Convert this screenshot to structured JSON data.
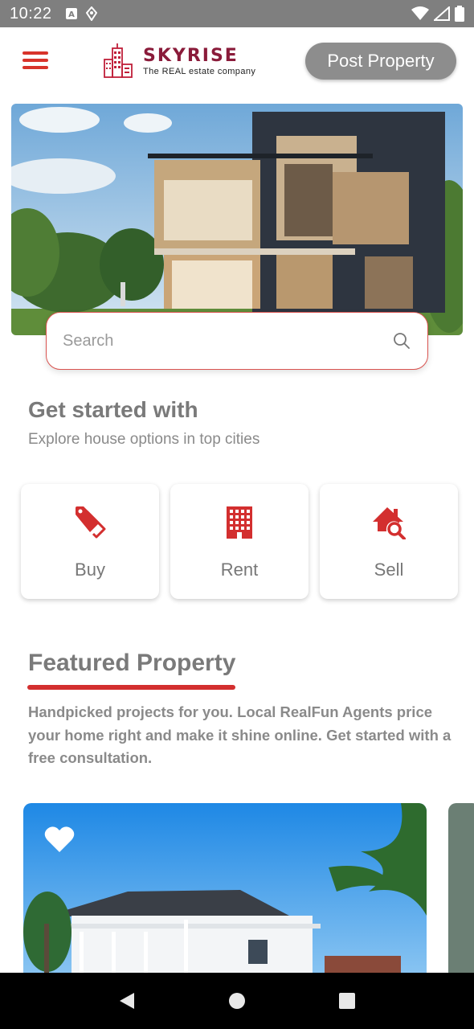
{
  "status_bar": {
    "time": "10:22"
  },
  "header": {
    "logo_title": "SKYRISE",
    "logo_tagline": "The REAL estate company",
    "post_button": "Post Property"
  },
  "search": {
    "placeholder": "Search"
  },
  "get_started": {
    "title": "Get started with",
    "subtitle": "Explore house options in top cities"
  },
  "categories": [
    {
      "label": "Buy",
      "icon": "tag-icon"
    },
    {
      "label": "Rent",
      "icon": "building-icon"
    },
    {
      "label": "Sell",
      "icon": "house-search-icon"
    }
  ],
  "featured": {
    "title": "Featured Property",
    "description": "Handpicked projects for you. Local RealFun Agents price your home right and make it shine online. Get started with a free consultation."
  },
  "colors": {
    "accent": "#d32f2f",
    "logo": "#8a1b3a",
    "button_gray": "#8d8d8d"
  }
}
